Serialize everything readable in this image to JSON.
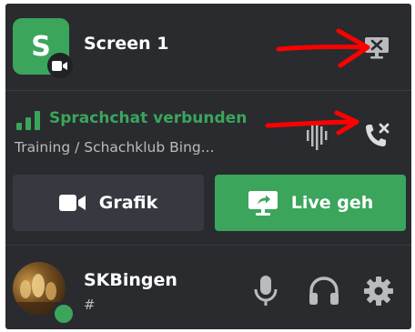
{
  "screen": {
    "avatar_letter": "S",
    "name": "Screen 1",
    "stop_screen_icon": "monitor-x-icon"
  },
  "voice": {
    "status": "Sprachchat verbunden",
    "channel": "Training / Schachklub Bing...",
    "noise_icon": "noise-suppression-icon",
    "disconnect_icon": "phone-disconnect-icon"
  },
  "actions": {
    "video_label": "Grafik",
    "live_label": "Live geh"
  },
  "user": {
    "name": "SKBingen",
    "tag": "#",
    "status": "online"
  },
  "colors": {
    "panel": "#292b2f",
    "green": "#3ba55c",
    "button_dark": "#36393f",
    "muted_text": "#b9bbbe",
    "annotation": "#ff0000"
  }
}
